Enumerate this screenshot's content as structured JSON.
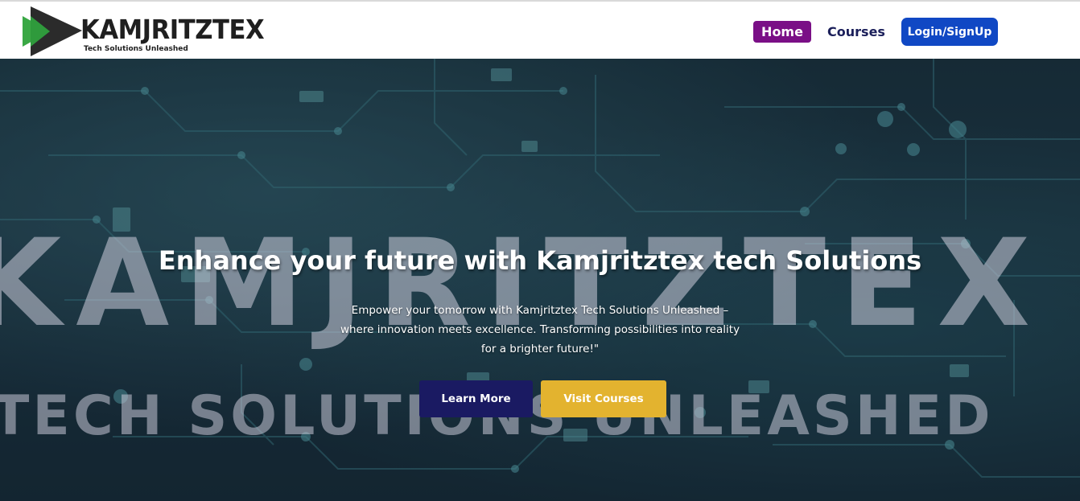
{
  "brand": {
    "name": "KAMJRITZTEX",
    "tagline": "Tech Solutions Unleashed",
    "logo_icon": "play-arrow-logo-icon",
    "colors": {
      "triangle_dark": "#2b2b2b",
      "triangle_green": "#3aa845"
    }
  },
  "nav": {
    "items": [
      {
        "label": "Home",
        "active": true
      },
      {
        "label": "Courses",
        "active": false
      },
      {
        "label": "Login/SignUp",
        "active": false
      }
    ],
    "colors": {
      "home_bg": "#7a0f86",
      "courses_text": "#1b1f5a",
      "login_bg": "#1048c4"
    }
  },
  "hero": {
    "watermark_top": "KAMJRITZTEX",
    "watermark_bottom": "TECH SOLUTIONS UNLEASHED",
    "title": "Enhance your future with Kamjritztex tech Solutions",
    "subtitle_lines": [
      "Empower your tomorrow with Kamjritztex Tech Solutions Unleashed –",
      "where innovation meets excellence. Transforming possibilities into reality",
      "for a brighter future!\""
    ],
    "buttons": {
      "learn_more": "Learn More",
      "visit_courses": "Visit Courses"
    },
    "colors": {
      "learn_more_bg": "#1a1a62",
      "visit_courses_bg": "#e3b32f"
    }
  }
}
